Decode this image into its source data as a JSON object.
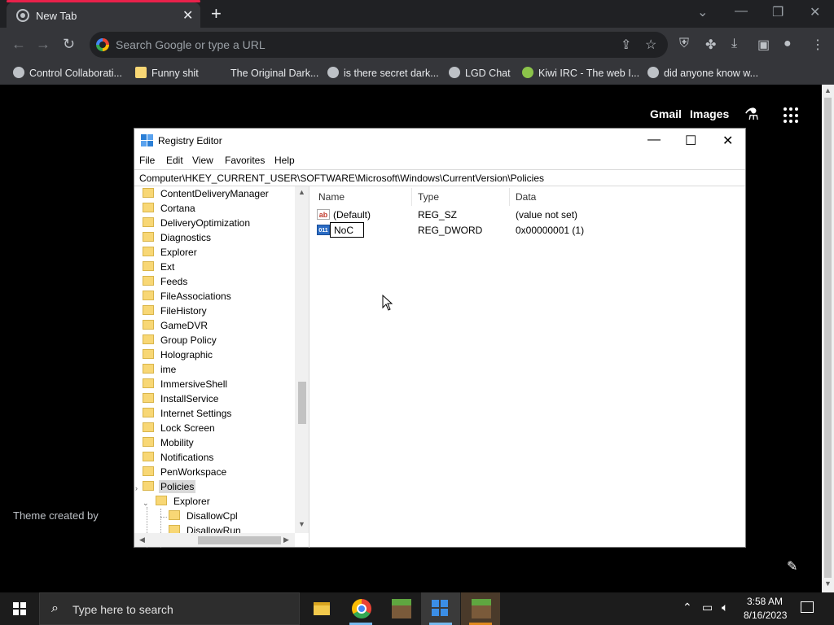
{
  "browser": {
    "tab_title": "New Tab",
    "omnibox_placeholder": "Search Google or type a URL",
    "bookmarks": [
      "Control Collaborati...",
      "Funny shit",
      "The Original Dark...",
      "is there secret dark...",
      "LGD Chat",
      "Kiwi IRC - The web I...",
      "did anyone know w..."
    ]
  },
  "ntp": {
    "gmail": "Gmail",
    "images": "Images",
    "theme_credit": "Theme created by"
  },
  "regedit": {
    "title": "Registry Editor",
    "menu": [
      "File",
      "Edit",
      "View",
      "Favorites",
      "Help"
    ],
    "address": "Computer\\HKEY_CURRENT_USER\\SOFTWARE\\Microsoft\\Windows\\CurrentVersion\\Policies",
    "tree": [
      "ContentDeliveryManager",
      "Cortana",
      "DeliveryOptimization",
      "Diagnostics",
      "Explorer",
      "Ext",
      "Feeds",
      "FileAssociations",
      "FileHistory",
      "GameDVR",
      "Group Policy",
      "Holographic",
      "ime",
      "ImmersiveShell",
      "InstallService",
      "Internet Settings",
      "Lock Screen",
      "Mobility",
      "Notifications",
      "PenWorkspace",
      "Policies"
    ],
    "tree_children": {
      "policies_child": "Explorer",
      "explorer_children": [
        "DisallowCpl",
        "DisallowRun"
      ]
    },
    "columns": {
      "name": "Name",
      "type": "Type",
      "data": "Data"
    },
    "values": [
      {
        "icon": "string-value-icon",
        "name": "(Default)",
        "type": "REG_SZ",
        "data": "(value not set)"
      },
      {
        "icon": "dword-value-icon",
        "name": "NoC",
        "type": "REG_DWORD",
        "data": "0x00000001 (1)"
      }
    ]
  },
  "taskbar": {
    "search_placeholder": "Type here to search",
    "time": "3:58 AM",
    "date": "8/16/2023",
    "active_color": "#76b9ed"
  },
  "colors": {
    "tab_accent": "#e8214a",
    "chrome_bg": "#35363a",
    "page_bg": "#000000"
  }
}
